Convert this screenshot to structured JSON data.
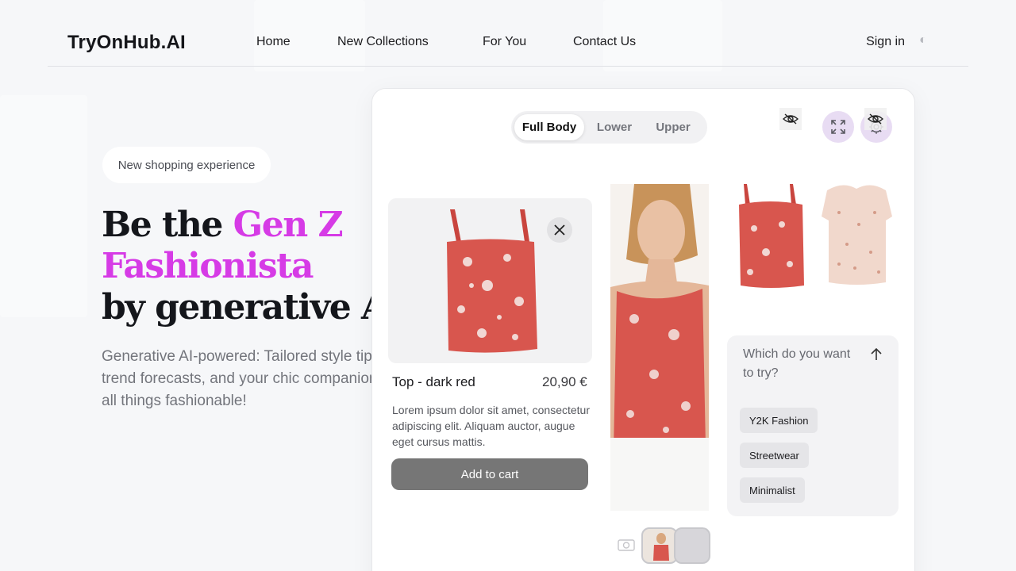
{
  "brand": "TryOnHub.AI",
  "nav": {
    "links": [
      "Home",
      "New Collections",
      "For You",
      "Contact Us"
    ],
    "signin": "Sign in",
    "theme_glyph": "◐"
  },
  "hero": {
    "badge": "New shopping experience",
    "title_line1_start": "Be the ",
    "title_accent": "Gen Z Fashionista",
    "title_accent_line1": "Gen Z",
    "title_accent_line2": "Fashionista",
    "title_line3": "by generative AI!",
    "description": "Generative AI-powered: Tailored style tips, trend forecasts, and your chic companion for all things fashionable!"
  },
  "panel": {
    "segments": [
      "Full Body",
      "Lower",
      "Upper"
    ],
    "active_segment": "Full Body",
    "icons": [
      "expand-icon",
      "settings-icon"
    ],
    "product": {
      "name": "Top - dark red",
      "price": "20,90 €",
      "description": "Lorem ipsum dolor sit amet, consectetur adipiscing elit. Aliquam auctor, augue eget cursus mattis.",
      "cta": "Add to cart"
    },
    "chat": {
      "question": "Which do you want to try?",
      "tags": [
        "Y2K Fashion",
        "Streetwear",
        "Minimalist"
      ]
    }
  },
  "colors": {
    "accent": "#d63be6",
    "icon_bg": "#e8dcf3",
    "garment_red": "#d8564e",
    "cart_button": "#767676"
  }
}
